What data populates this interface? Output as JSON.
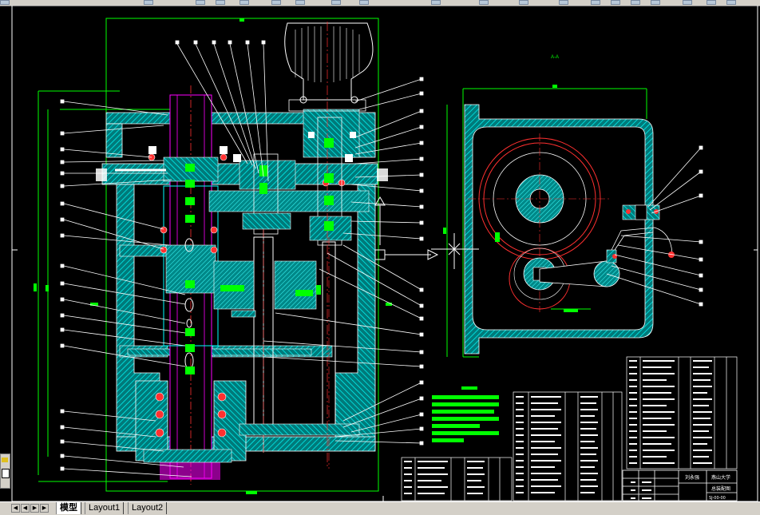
{
  "app": {
    "name": "AutoCAD drawing window",
    "background_color": "#000000"
  },
  "layout_tabs": [
    {
      "label": "模型",
      "active": true
    },
    {
      "label": "Layout1",
      "active": false
    },
    {
      "label": "Layout2",
      "active": false
    }
  ],
  "nav_buttons": [
    "first-icon",
    "prev-icon",
    "next-icon",
    "last-icon"
  ],
  "drawing": {
    "colors": {
      "outline": "#00ff00",
      "section": "#00c0c0",
      "hatch": "#00e0e0",
      "white": "#ffffff",
      "red": "#ff3030",
      "magenta": "#ff00ff",
      "label_block": "#00ff00"
    },
    "title_block": {
      "school": "燕山大学",
      "drawing_name": "总装配图",
      "designer": "刘永强",
      "code": "SJ-00-00"
    },
    "view_label_side": "A-A"
  }
}
